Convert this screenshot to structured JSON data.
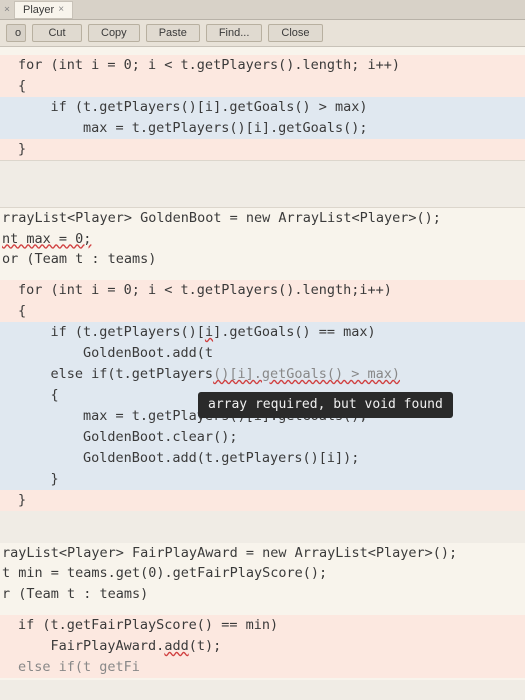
{
  "tab": {
    "name": "Player",
    "close": "×",
    "prev": "×"
  },
  "toolbar": {
    "o": "o",
    "cut": "Cut",
    "copy": "Copy",
    "paste": "Paste",
    "find": "Find...",
    "close": "Close"
  },
  "tooltip": "array required, but void found",
  "code": {
    "l1": "for (int i = 0; i < t.getPlayers().length; i++)",
    "l2": "{",
    "l3": "    if (t.getPlayers()[i].getGoals() > max)",
    "l4": "        max = t.getPlayers()[i].getGoals();",
    "l5": "}",
    "l6": "rrayList<Player> GoldenBoot = new ArrayList<Player>();",
    "l7": "nt max = 0;",
    "l8": "or (Team t : teams)",
    "l9": "for (int i = 0; i < t.getPlayers().length;i++)",
    "l10": "{",
    "l11a": "    if (t.getPlayers()[",
    "l11b": "i",
    "l11c": "].getGoals() == max)",
    "l12": "        GoldenBoot.add(t",
    "l13a": "    else if(t.getPlayers",
    "l13b": "()[i].getGoals() > max)",
    "l14": "    {",
    "l15": "        max = t.getPlayers()[i].getGoals();",
    "l16": "        GoldenBoot.clear();",
    "l17": "        GoldenBoot.add(t.getPlayers()[i]);",
    "l18": "    }",
    "l19": "}",
    "l20": "rayList<Player> FairPlayAward = new ArrayList<Player>();",
    "l21": "t min = teams.get(0).getFairPlayScore();",
    "l22": "r (Team t : teams)",
    "l23": "if (t.getFairPlayScore() == min)",
    "l24a": "    FairPlayAward.",
    "l24b": "add",
    "l24c": "(t);",
    "l25a": "else if(t getF",
    "l25b": "i"
  }
}
